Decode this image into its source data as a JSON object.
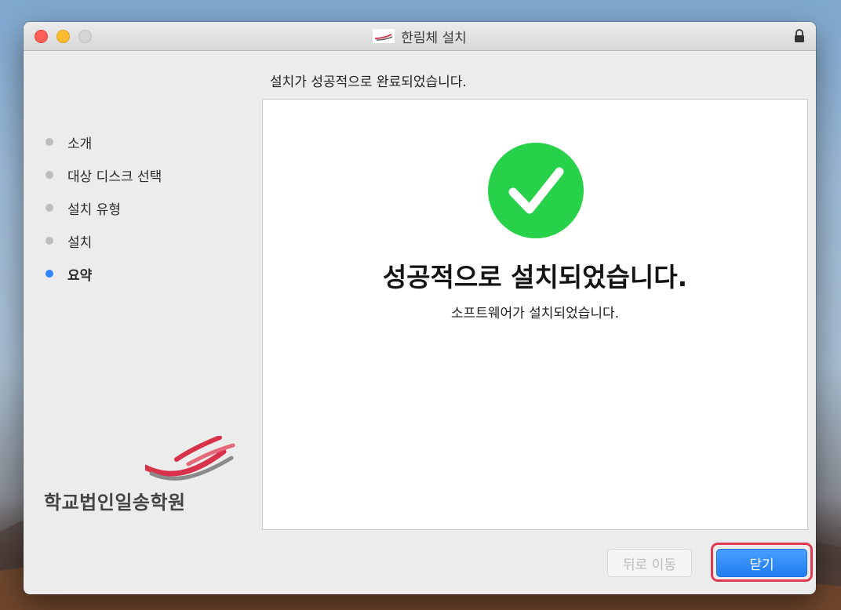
{
  "window": {
    "title": "한림체 설치",
    "header_message": "설치가 성공적으로 완료되었습니다."
  },
  "sidebar": {
    "steps": [
      {
        "label": "소개",
        "active": false
      },
      {
        "label": "대상 디스크 선택",
        "active": false
      },
      {
        "label": "설치 유형",
        "active": false
      },
      {
        "label": "설치",
        "active": false
      },
      {
        "label": "요약",
        "active": true
      }
    ],
    "logo_text": "학교법인일송학원"
  },
  "main": {
    "success_icon": "checkmark-circle-icon",
    "title": "성공적으로 설치되었습니다.",
    "subtitle": "소프트웨어가 설치되었습니다."
  },
  "buttons": {
    "back_label": "뒤로 이동",
    "close_label": "닫기"
  },
  "colors": {
    "success_green": "#28d14a",
    "active_dot": "#2f86ff",
    "highlight_red": "#e03a52",
    "primary_button": "#1f7cf0"
  }
}
